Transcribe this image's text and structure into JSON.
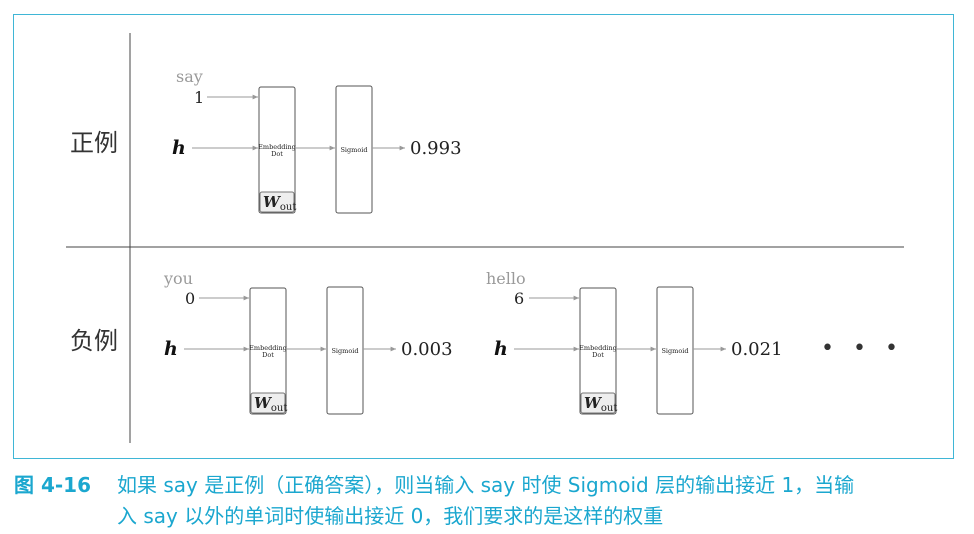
{
  "positive_label": "正例",
  "negative_label": "负例",
  "examples": [
    {
      "word": "say",
      "index": "1",
      "h": "h",
      "embed_line1": "Embedding",
      "embed_line2": "Dot",
      "sigmoid": "Sigmoid",
      "weight": "W",
      "weight_sub": "out",
      "output": "0.993"
    },
    {
      "word": "you",
      "index": "0",
      "h": "h",
      "embed_line1": "Embedding",
      "embed_line2": "Dot",
      "sigmoid": "Sigmoid",
      "weight": "W",
      "weight_sub": "out",
      "output": "0.003"
    },
    {
      "word": "hello",
      "index": "6",
      "h": "h",
      "embed_line1": "Embedding",
      "embed_line2": "Dot",
      "sigmoid": "Sigmoid",
      "weight": "W",
      "weight_sub": "out",
      "output": "0.021"
    }
  ],
  "ellipsis": "• • •",
  "caption": {
    "figure_number": "图 4-16",
    "line1": "如果 say 是正例（正确答案），则当输入 say 时使 Sigmoid 层的输出接近 1，当输",
    "line2": "入 say 以外的单词时使输出接近 0，我们要求的是这样的权重"
  },
  "colors": {
    "frame": "#3fb6d6",
    "caption": "#1ba7cf",
    "arrow": "#999999",
    "box": "#555555"
  }
}
